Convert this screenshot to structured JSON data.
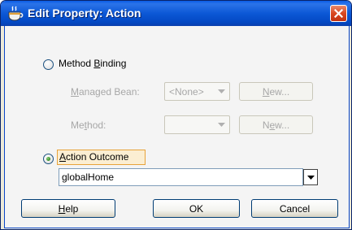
{
  "dialog": {
    "title": "Edit Property: Action",
    "title_icon": "coffee-cup-icon",
    "close_icon": "close-icon"
  },
  "method_binding": {
    "label_pre": "Method ",
    "label_ul": "B",
    "label_post": "inding",
    "selected": false,
    "managed_bean": {
      "label_ul": "M",
      "label_rest": "anaged Bean:",
      "value": "<None>",
      "new_pre": "",
      "new_ul": "N",
      "new_post": "ew..."
    },
    "method": {
      "label_pre": "Me",
      "label_ul": "t",
      "label_post": "hod:",
      "value": "",
      "new_pre": "N",
      "new_ul": "e",
      "new_post": "w..."
    }
  },
  "action_outcome": {
    "label_ul": "A",
    "label_rest": "ction Outcome",
    "selected": true,
    "value": "globalHome"
  },
  "buttons": {
    "help_ul": "H",
    "help_rest": "elp",
    "ok": "OK",
    "cancel": "Cancel"
  }
}
